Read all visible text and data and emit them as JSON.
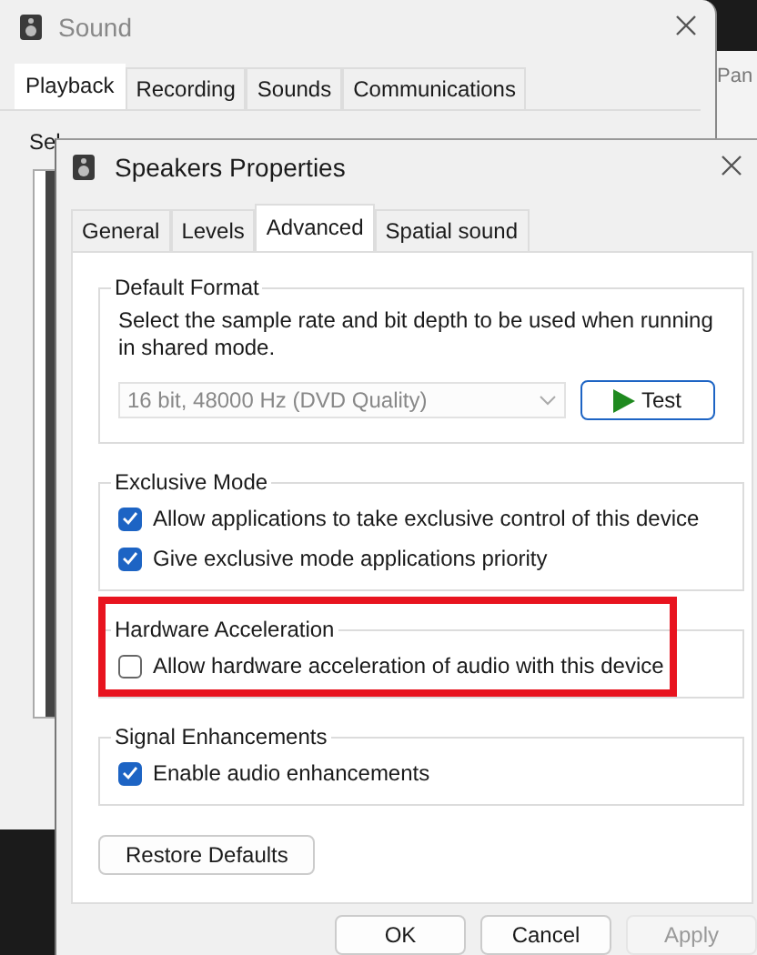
{
  "background_window": {
    "text": "Pan"
  },
  "sound_window": {
    "title": "Sound",
    "tabs": [
      {
        "label": "Playback",
        "selected": true
      },
      {
        "label": "Recording",
        "selected": false
      },
      {
        "label": "Sounds",
        "selected": false
      },
      {
        "label": "Communications",
        "selected": false
      }
    ],
    "instruction": "Sel"
  },
  "dialog": {
    "title": "Speakers Properties",
    "tabs": [
      {
        "label": "General",
        "selected": false
      },
      {
        "label": "Levels",
        "selected": false
      },
      {
        "label": "Advanced",
        "selected": true
      },
      {
        "label": "Spatial sound",
        "selected": false
      }
    ],
    "default_format": {
      "title": "Default Format",
      "description": "Select the sample rate and bit depth to be used when running in shared mode.",
      "format": {
        "value": "16 bit, 48000 Hz (DVD Quality)",
        "disabled": true
      },
      "test_button": "Test"
    },
    "groups": [
      {
        "title": "Exclusive Mode",
        "highlighted": false,
        "options": [
          {
            "label": "Allow applications to take exclusive control of this device",
            "checked": true
          },
          {
            "label": "Give exclusive mode applications priority",
            "checked": true
          }
        ]
      },
      {
        "title": "Hardware Acceleration",
        "highlighted": true,
        "options": [
          {
            "label": "Allow hardware acceleration of audio with this device",
            "checked": false
          }
        ]
      },
      {
        "title": "Signal Enhancements",
        "highlighted": false,
        "options": [
          {
            "label": "Enable audio enhancements",
            "checked": true
          }
        ]
      }
    ],
    "restore_button": "Restore Defaults",
    "buttons": [
      {
        "label": "OK",
        "disabled": false
      },
      {
        "label": "Cancel",
        "disabled": false
      },
      {
        "label": "Apply",
        "disabled": true
      }
    ]
  }
}
